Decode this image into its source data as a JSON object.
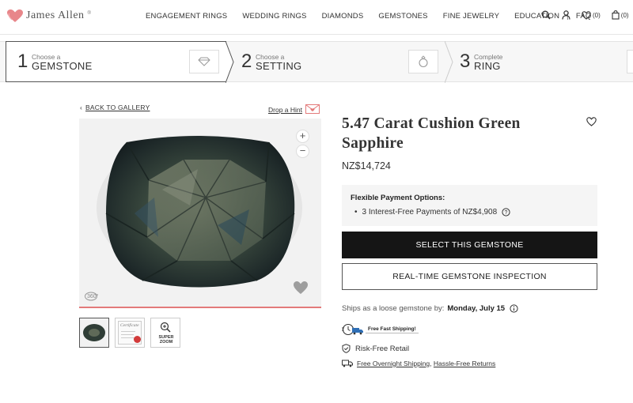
{
  "brand": {
    "logo_text": "James Allen",
    "accent": "#e37a7a"
  },
  "nav": {
    "items": [
      "ENGAGEMENT RINGS",
      "WEDDING RINGS",
      "DIAMONDS",
      "GEMSTONES",
      "FINE JEWELRY",
      "EDUCATION"
    ],
    "separator": "|",
    "faq": "FAQ",
    "wishlist_count": "(0)",
    "cart_count": "(0)"
  },
  "steps": [
    {
      "number": "1",
      "small": "Choose a",
      "big": "GEMSTONE",
      "icon": "diamond-icon"
    },
    {
      "number": "2",
      "small": "Choose a",
      "big": "SETTING",
      "icon": "ring-icon"
    },
    {
      "number": "3",
      "small": "Complete",
      "big": "RING",
      "icon": "ring-icon"
    }
  ],
  "gallery": {
    "back_label": "BACK TO GALLERY",
    "hint_label": "Drop a Hint",
    "view360_label": "360°",
    "thumbs": [
      "gemstone-photo",
      "certificate",
      "super-zoom"
    ],
    "cert_label": "Certificate",
    "superzoom_label": "SUPER ZOOM",
    "gem_color": "#2f3d36"
  },
  "product": {
    "title": "5.47 Carat Cushion Green Sapphire",
    "price": "NZ$14,724",
    "payment_title": "Flexible Payment Options:",
    "payment_item": "3 Interest-Free Payments of NZ$4,908",
    "select_button": "SELECT THIS GEMSTONE",
    "inspection_button": "REAL-TIME GEMSTONE INSPECTION",
    "ships_prefix": "Ships as a loose gemstone by:",
    "ships_date": "Monday, July 15",
    "free_shipping": "Free Fast Shipping!",
    "risk_free": "Risk-Free Retail",
    "overnight_shipping": "Free Overnight Shipping",
    "returns": "Hassle-Free Returns"
  }
}
